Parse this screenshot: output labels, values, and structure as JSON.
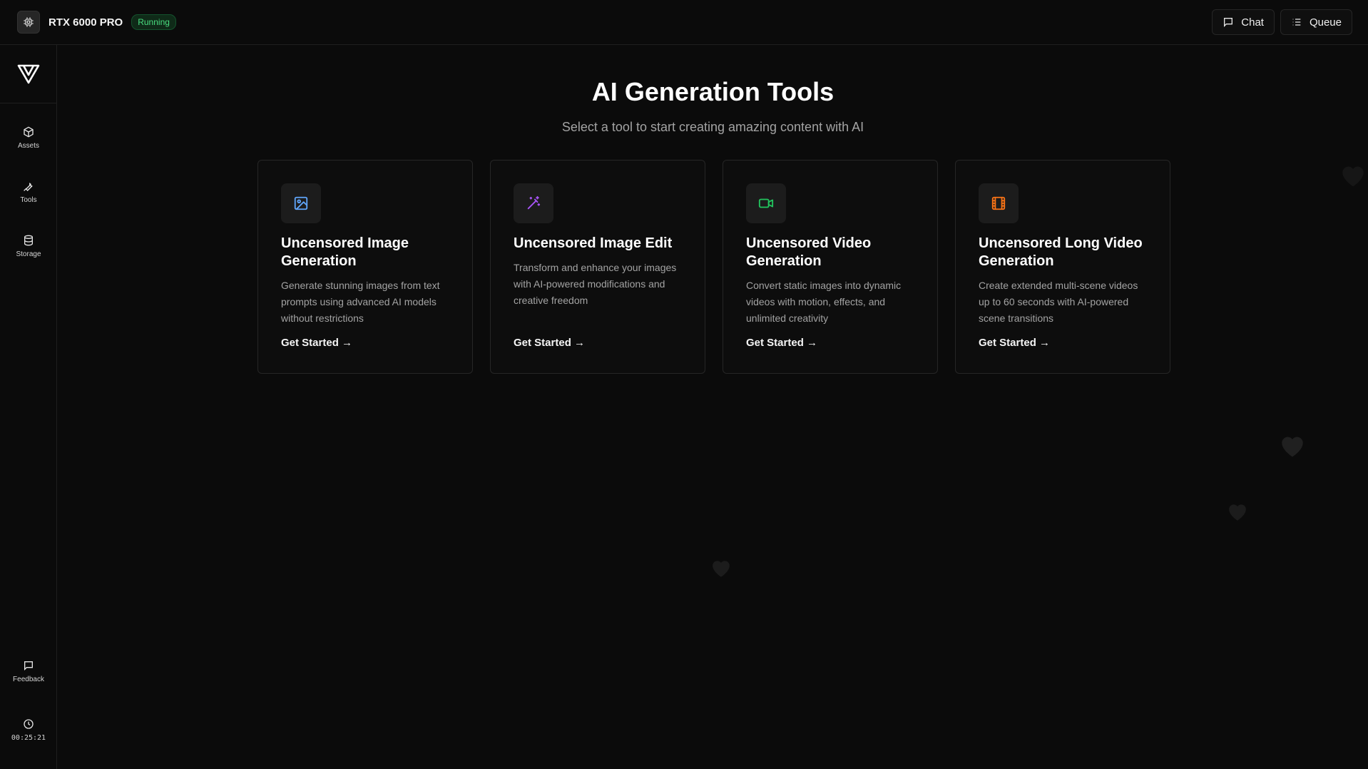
{
  "topbar": {
    "gpu_name": "RTX 6000 PRO",
    "status": "Running",
    "chat_label": "Chat",
    "queue_label": "Queue"
  },
  "sidebar": {
    "items": [
      {
        "label": "Assets",
        "icon": "cube-icon"
      },
      {
        "label": "Tools",
        "icon": "wrench-icon"
      },
      {
        "label": "Storage",
        "icon": "database-icon"
      }
    ],
    "feedback_label": "Feedback",
    "timer": "00:25:21"
  },
  "main": {
    "title": "AI Generation Tools",
    "subtitle": "Select a tool to start creating amazing content with AI",
    "cards": [
      {
        "title": "Uncensored Image Generation",
        "description": "Generate stunning images from text prompts using advanced AI models without restrictions",
        "cta": "Get Started →",
        "icon": "image-icon",
        "color": "#60a5fa"
      },
      {
        "title": "Uncensored Image Edit",
        "description": "Transform and enhance your images with AI-powered modifications and creative freedom",
        "cta": "Get Started →",
        "icon": "magic-wand-icon",
        "color": "#a855f7"
      },
      {
        "title": "Uncensored Video Generation",
        "description": "Convert static images into dynamic videos with motion, effects, and unlimited creativity",
        "cta": "Get Started →",
        "icon": "video-icon",
        "color": "#22c55e"
      },
      {
        "title": "Uncensored Long Video Generation",
        "description": "Create extended multi-scene videos up to 60 seconds with AI-powered scene transitions",
        "cta": "Get Started →",
        "icon": "film-icon",
        "color": "#f97316"
      }
    ]
  },
  "colors": {
    "background": "#0b0b0b",
    "status_green": "#4ade80"
  }
}
